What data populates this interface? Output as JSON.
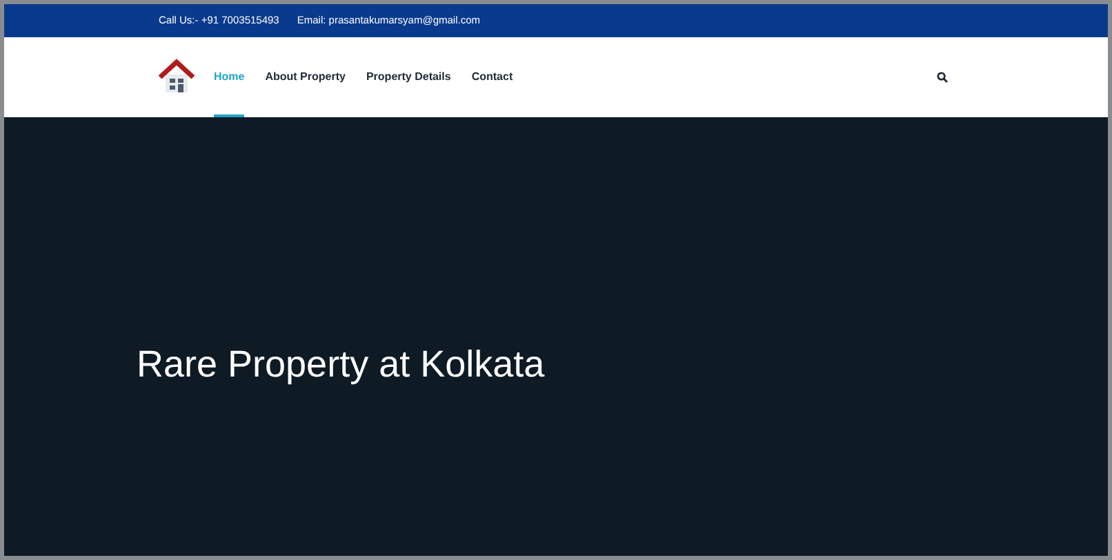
{
  "top_bar": {
    "phone": "Call Us:- +91 7003515493",
    "email": "Email: prasantakumarsyam@gmail.com"
  },
  "nav": {
    "items": [
      {
        "label": "Home",
        "selected": true
      },
      {
        "label": "About Property",
        "selected": false
      },
      {
        "label": "Property Details",
        "selected": false
      },
      {
        "label": "Contact",
        "selected": false
      }
    ]
  },
  "hero": {
    "title": "Rare Property at Kolkata"
  }
}
